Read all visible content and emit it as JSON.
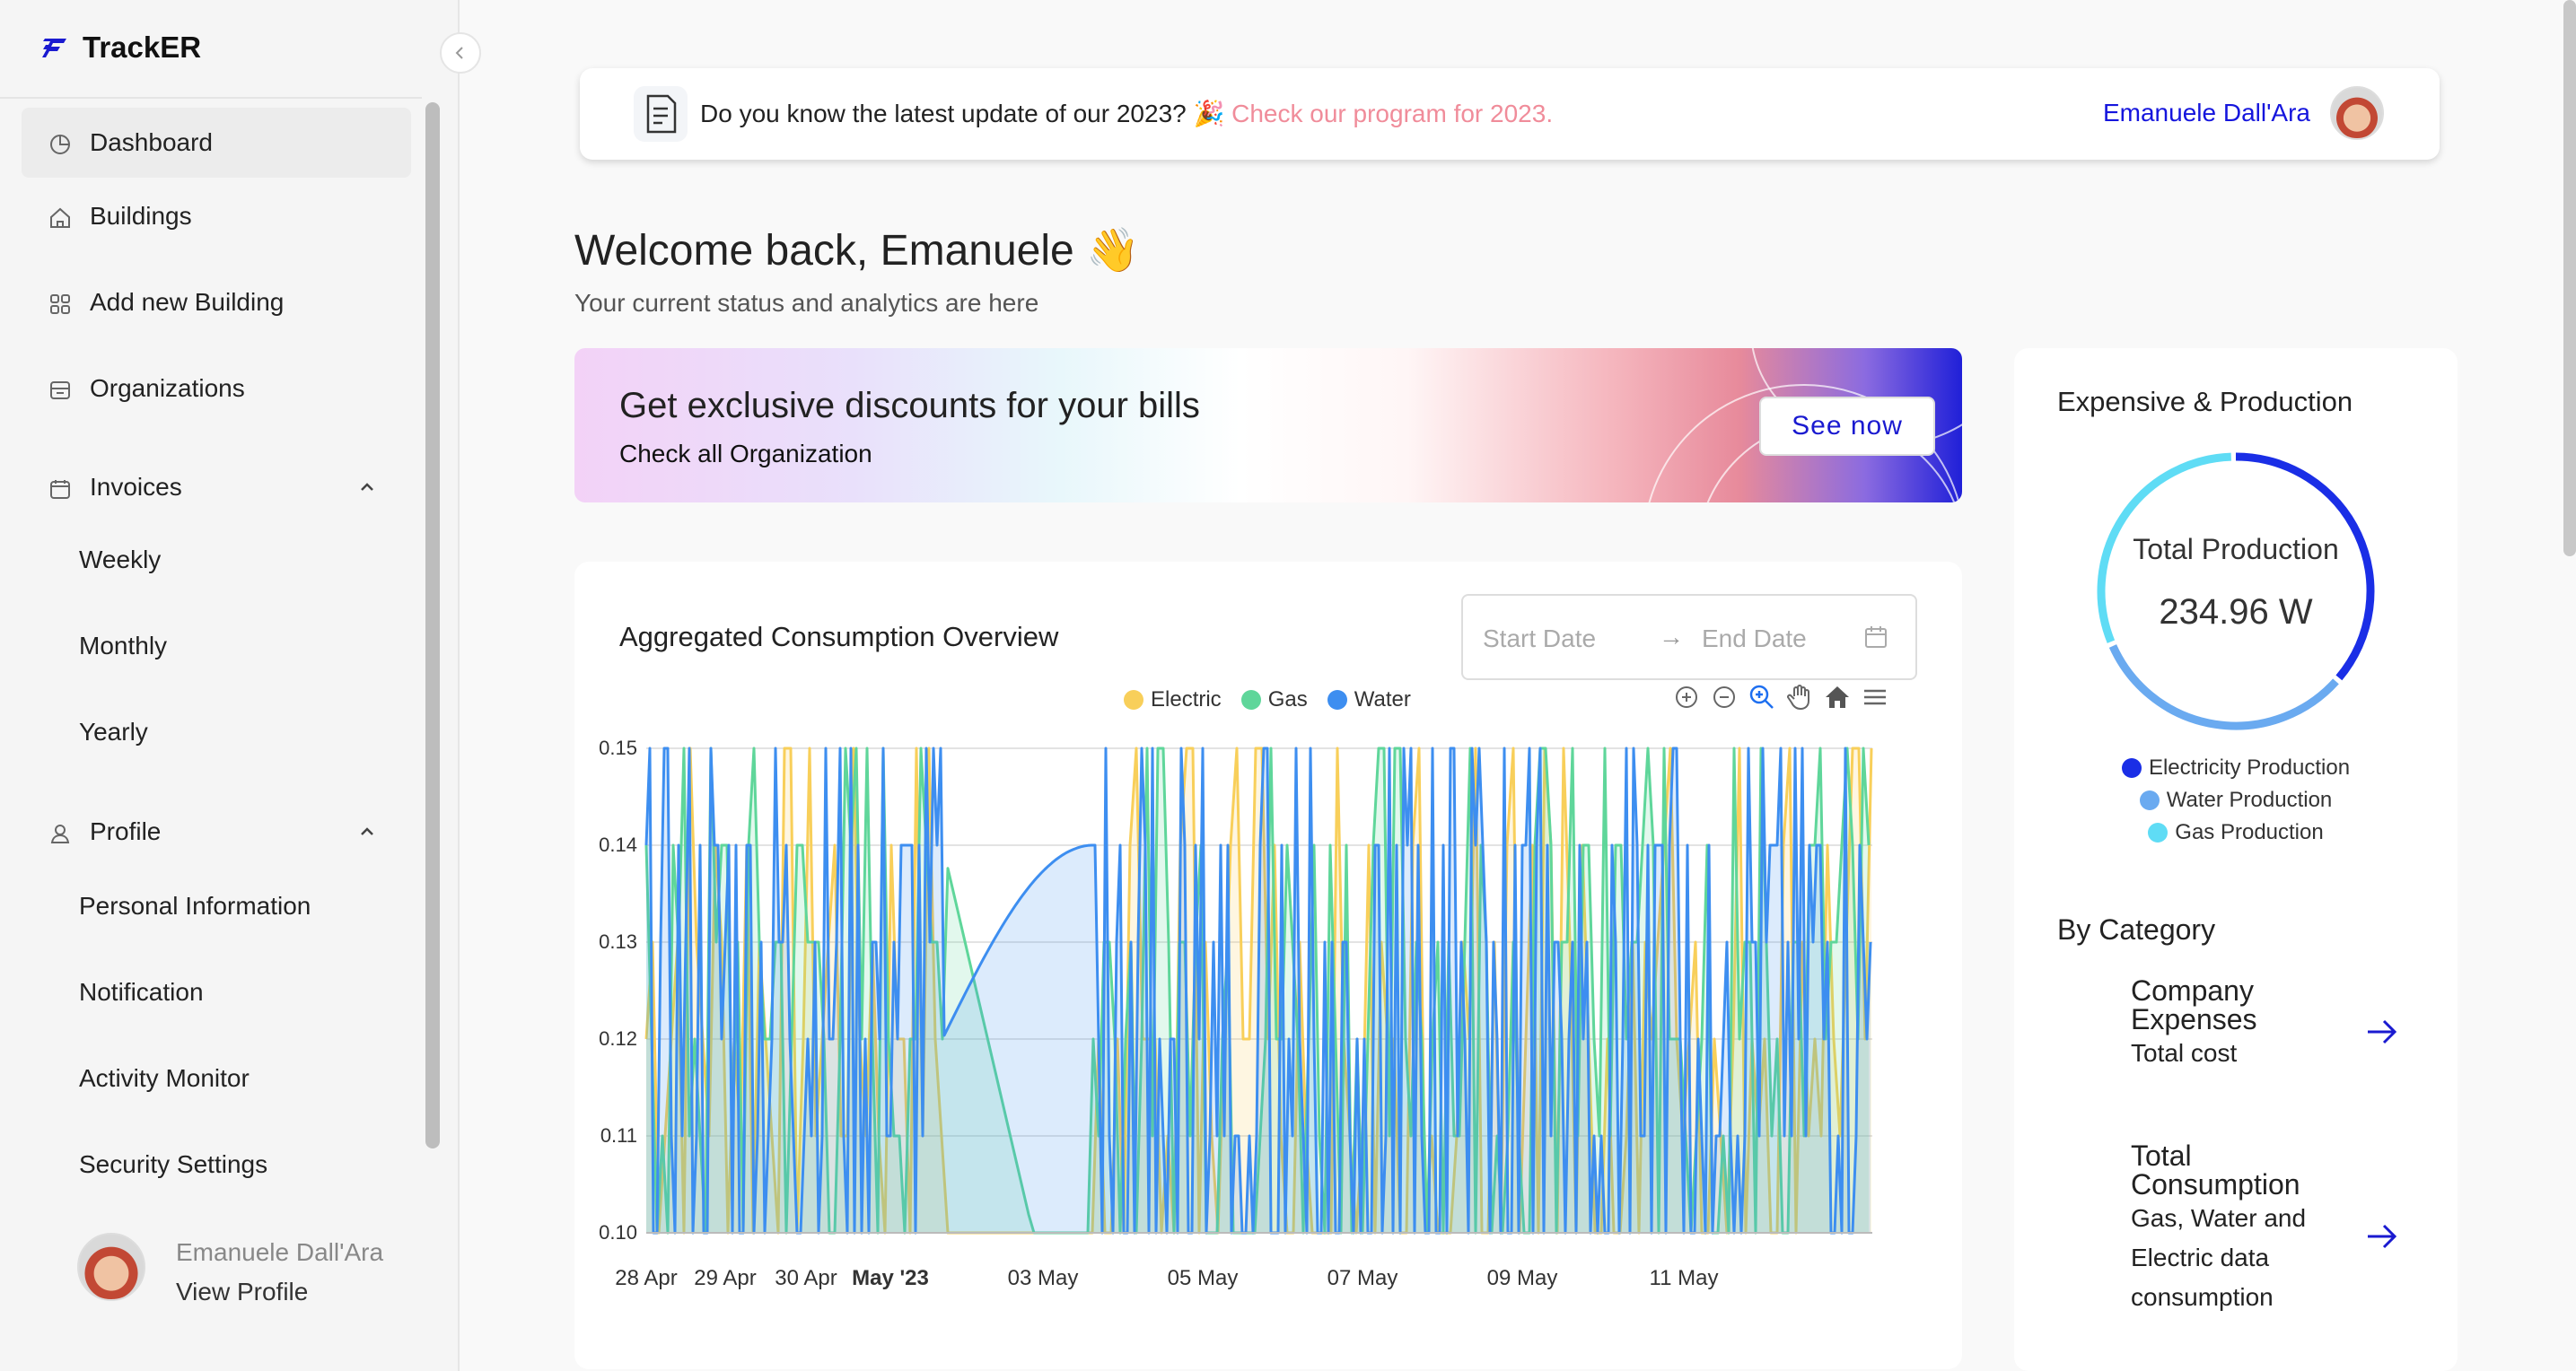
{
  "app": {
    "name": "TrackER",
    "brand_color": "#1a1ad0"
  },
  "sidebar": {
    "items": [
      {
        "label": "Dashboard",
        "icon": "pie-chart-icon",
        "active": true
      },
      {
        "label": "Buildings",
        "icon": "home-icon"
      },
      {
        "label": "Add new Building",
        "icon": "grid-icon"
      },
      {
        "label": "Organizations",
        "icon": "store-icon"
      },
      {
        "label": "Invoices",
        "icon": "calendar-icon",
        "expanded": true,
        "children": [
          "Weekly",
          "Monthly",
          "Yearly"
        ]
      },
      {
        "label": "Profile",
        "icon": "user-icon",
        "expanded": true,
        "children": [
          "Personal Information",
          "Notification",
          "Activity Monitor",
          "Security Settings"
        ]
      }
    ],
    "user": {
      "name": "Emanuele Dall'Ara",
      "link": "View Profile"
    }
  },
  "topbar": {
    "message": "Do you know the latest update of our 2023? 🎉 ",
    "link": "Check our program for 2023.",
    "user_name": "Emanuele Dall'Ara"
  },
  "welcome": {
    "title": "Welcome back, Emanuele 👋",
    "subtitle": "Your current status and analytics are here"
  },
  "banner": {
    "title": "Get exclusive discounts for your bills",
    "subtitle": "Check all Organization",
    "button": "See now"
  },
  "consumption_card": {
    "title": "Aggregated Consumption Overview",
    "start_placeholder": "Start Date",
    "end_placeholder": "End Date",
    "toolbar_icons": [
      "zoom-in-icon",
      "zoom-out-icon",
      "zoom-select-icon",
      "pan-icon",
      "reset-home-icon",
      "menu-icon"
    ]
  },
  "chart_data": {
    "type": "area",
    "x": [
      "28 Apr",
      "29 Apr",
      "30 Apr",
      "May '23",
      "03 May",
      "05 May",
      "07 May",
      "09 May",
      "11 May"
    ],
    "x_tick_bold": "May '23",
    "ylim": [
      0.1,
      0.15
    ],
    "y_ticks": [
      "0.15",
      "0.14",
      "0.13",
      "0.12",
      "0.11",
      "0.10"
    ],
    "grid": true,
    "legend_position": "top-center",
    "series": [
      {
        "name": "Electric",
        "color": "#f8cf5a"
      },
      {
        "name": "Gas",
        "color": "#5fd69a"
      },
      {
        "name": "Water",
        "color": "#3d8ef0"
      }
    ]
  },
  "production": {
    "title": "Expensive & Production",
    "center_label": "Total Production",
    "center_value": "234.96 W",
    "legend": [
      {
        "name": "Electricity Production",
        "color": "#1a2ee6"
      },
      {
        "name": "Water Production",
        "color": "#6aaaf0"
      },
      {
        "name": "Gas Production",
        "color": "#5fdcf5"
      }
    ]
  },
  "category": {
    "title": "By Category",
    "items": [
      {
        "title": "Company Expenses",
        "subtitle": "Total cost"
      },
      {
        "title": "Total Consumption",
        "subtitle": "Gas, Water and Electric data consumption"
      }
    ]
  }
}
